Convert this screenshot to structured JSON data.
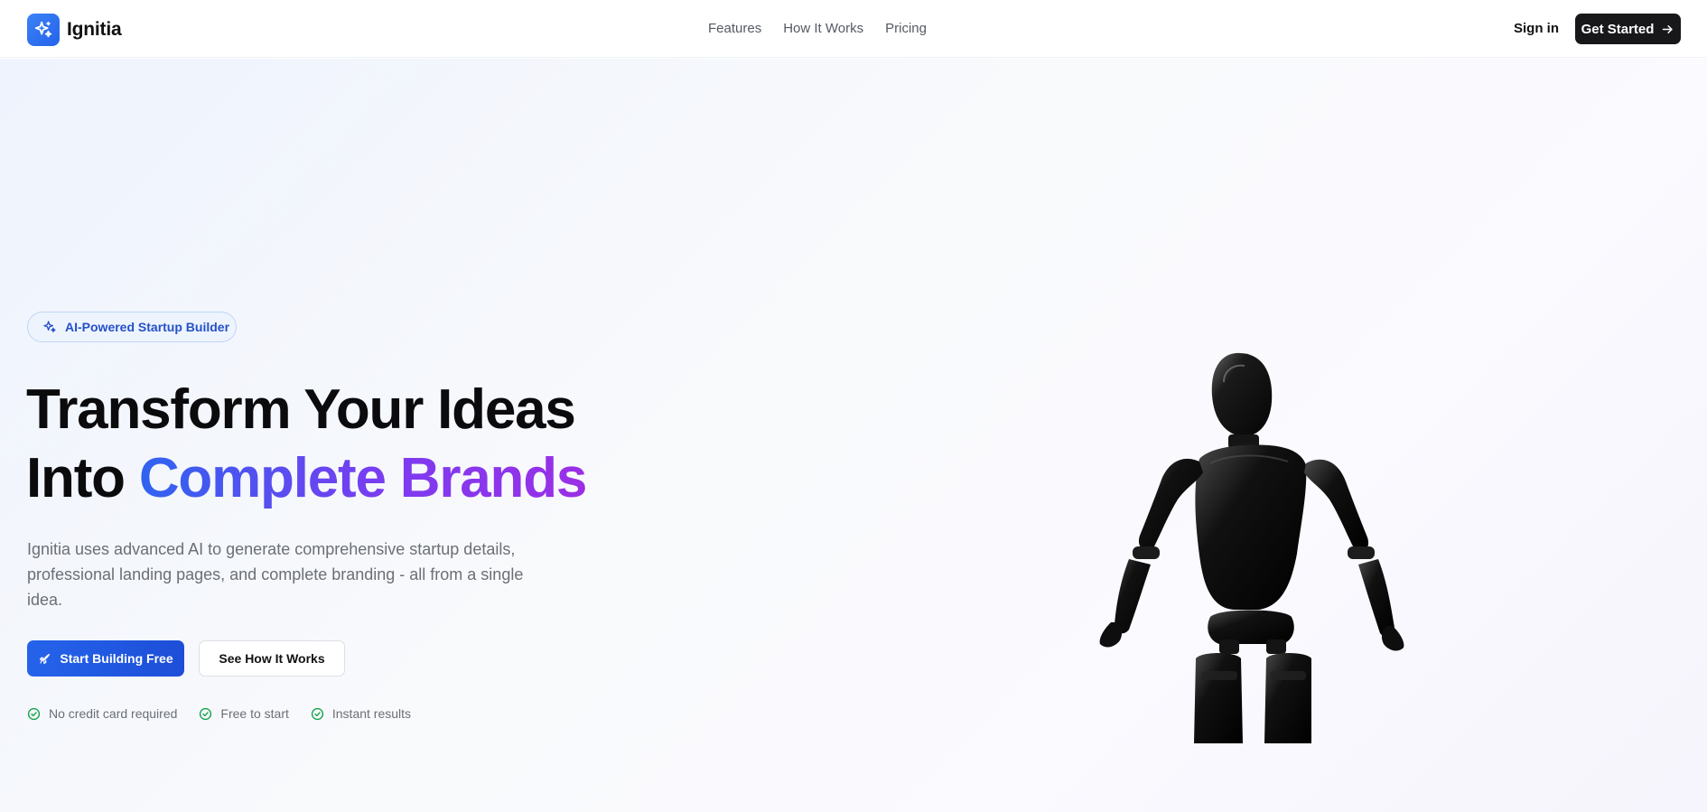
{
  "nav": {
    "brand": "Ignitia",
    "links": [
      "Features",
      "How It Works",
      "Pricing"
    ],
    "signin": "Sign in",
    "cta": "Get Started"
  },
  "hero": {
    "badge": "AI-Powered Startup Builder",
    "title_line1": "Transform Your Ideas",
    "title_line2_prefix": "Into ",
    "title_line2_highlight": "Complete Brands",
    "description": "Ignitia uses advanced AI to generate comprehensive startup details, professional landing pages, and complete branding - all from a single idea.",
    "primary_button": "Start Building Free",
    "secondary_button": "See How It Works",
    "checks": [
      "No credit card required",
      "Free to start",
      "Instant results"
    ]
  },
  "icons": {
    "logo": "sparkles-icon",
    "cta_arrow": "arrow-right-icon",
    "badge": "sparkles-icon",
    "primary_button": "rocket-icon",
    "check": "check-circle-icon"
  },
  "colors": {
    "accent": "#2563eb",
    "gradient_start": "#2f63f0",
    "gradient_end": "#9b2fe6",
    "check_green": "#16a34a",
    "dark_button": "#18181b"
  }
}
